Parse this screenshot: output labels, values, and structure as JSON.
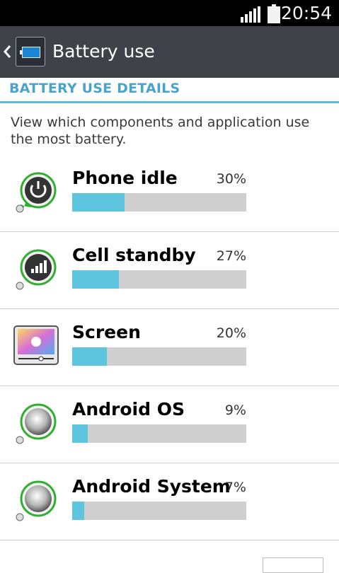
{
  "status_bar": {
    "time": "20:54",
    "signal_icon": "signal-bars-icon",
    "battery_icon": "battery-icon"
  },
  "action_bar": {
    "title": "Battery use",
    "back_icon": "chevron-left-icon",
    "app_icon": "battery-app-icon"
  },
  "section": {
    "header": "BATTERY USE DETAILS",
    "description": "View which components and application use the most battery."
  },
  "items": [
    {
      "name": "Phone idle",
      "percent": "30%",
      "fraction": 0.3,
      "icon": "power-icon"
    },
    {
      "name": "Cell standby",
      "percent": "27%",
      "fraction": 0.27,
      "icon": "signal-icon"
    },
    {
      "name": "Screen",
      "percent": "20%",
      "fraction": 0.2,
      "icon": "brightness-icon"
    },
    {
      "name": "Android OS",
      "percent": "9%",
      "fraction": 0.09,
      "icon": "android-os-icon"
    },
    {
      "name": "Android System",
      "percent": "7%",
      "fraction": 0.07,
      "icon": "android-system-icon"
    }
  ],
  "colors": {
    "accent": "#4aa3c9",
    "bar_fill": "#5ec5df",
    "bar_track": "#cfcfcf",
    "action_bar": "#3f4349"
  }
}
